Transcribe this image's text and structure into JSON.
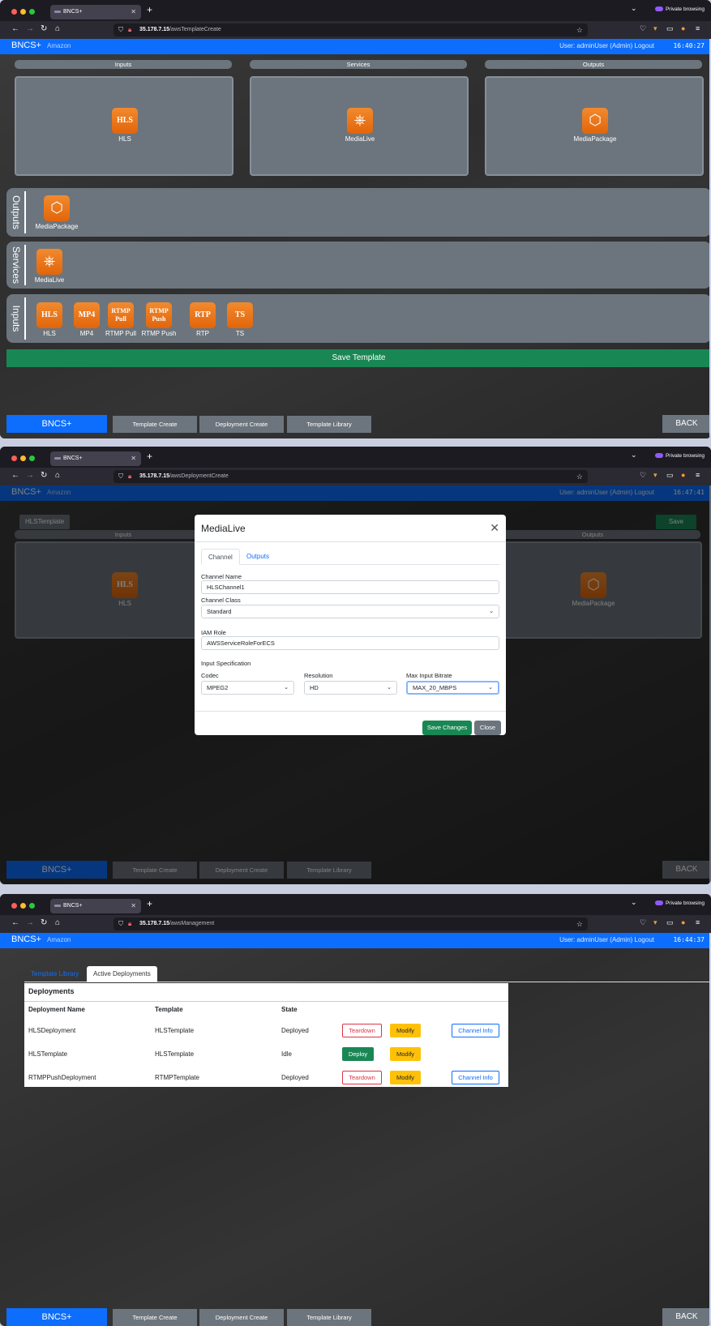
{
  "windows": [
    {
      "tab_title": "BNCS+",
      "private_label": "Private browsing",
      "url_host": "35.178.7.15",
      "url_path": "/awsTemplateCreate",
      "app": {
        "brand": "BNCS+",
        "provider": "Amazon",
        "user": "User: adminUser (Admin)  Logout",
        "clock": "16:40:27"
      },
      "columns": [
        {
          "header": "Inputs",
          "items": [
            {
              "icon": "HLS",
              "label": "HLS"
            }
          ]
        },
        {
          "header": "Services",
          "items": [
            {
              "icon": "medialive-icon",
              "label": "MediaLive"
            }
          ]
        },
        {
          "header": "Outputs",
          "items": [
            {
              "icon": "mediapackage-icon",
              "label": "MediaPackage"
            }
          ]
        }
      ],
      "palette": [
        {
          "section": "Outputs",
          "items": [
            {
              "icon": "mediapackage-icon",
              "label": "MediaPackage"
            }
          ]
        },
        {
          "section": "Services",
          "items": [
            {
              "icon": "medialive-icon",
              "label": "MediaLive"
            }
          ]
        },
        {
          "section": "Inputs",
          "items": [
            {
              "icon": "HLS",
              "label": "HLS"
            },
            {
              "icon": "MP4",
              "label": "MP4"
            },
            {
              "icon_line1": "RTMP",
              "icon_line2": "Pull",
              "label": "RTMP Pull"
            },
            {
              "icon_line1": "RTMP",
              "icon_line2": "Push",
              "label": "RTMP Push"
            },
            {
              "icon": "RTP",
              "label": "RTP"
            },
            {
              "icon": "TS",
              "label": "TS"
            }
          ]
        }
      ],
      "save_button": "Save Template",
      "bottom_nav": {
        "brand": "BNCS+",
        "items": [
          "Template Create",
          "Deployment Create",
          "Template Library"
        ],
        "back": "BACK"
      }
    },
    {
      "tab_title": "BNCS+",
      "private_label": "Private browsing",
      "url_host": "35.178.7.15",
      "url_path": "/awsDeploymentCreate",
      "app": {
        "brand": "BNCS+",
        "provider": "Amazon",
        "user": "User: adminUser (Admin)  Logout",
        "clock": "16:47:41"
      },
      "template_name": "HLSTemplate",
      "save_button": "Save",
      "columns": [
        {
          "header": "Inputs",
          "items": [
            {
              "icon": "HLS",
              "label": "HLS"
            }
          ]
        },
        {
          "header": "Outputs",
          "items": [
            {
              "icon": "mediapackage-icon",
              "label": "MediaPackage"
            }
          ]
        }
      ],
      "modal": {
        "title": "MediaLive",
        "tabs": [
          "Channel",
          "Outputs"
        ],
        "fields": {
          "channel_name": {
            "label": "Channel Name",
            "value": "HLSChannel1"
          },
          "channel_class": {
            "label": "Channel Class",
            "value": "Standard"
          },
          "iam_role": {
            "label": "IAM Role",
            "value": "AWSServiceRoleForECS"
          },
          "input_spec_label": "Input Specification",
          "codec": {
            "label": "Codec",
            "value": "MPEG2"
          },
          "resolution": {
            "label": "Resolution",
            "value": "HD"
          },
          "max_bitrate": {
            "label": "Max Input Bitrate",
            "value": "MAX_20_MBPS"
          }
        },
        "save": "Save Changes",
        "close": "Close"
      },
      "bottom_nav": {
        "brand": "BNCS+",
        "items": [
          "Template Create",
          "Deployment Create",
          "Template Library"
        ],
        "back": "BACK"
      }
    },
    {
      "tab_title": "BNCS+",
      "private_label": "Private browsing",
      "url_host": "35.178.7.15",
      "url_path": "/awsManagement",
      "app": {
        "brand": "BNCS+",
        "provider": "Amazon",
        "user": "User: adminUser (Admin)  Logout",
        "clock": "16:44:37"
      },
      "tabs": [
        "Template Library",
        "Active Deployments"
      ],
      "deployments": {
        "title": "Deployments",
        "headers": [
          "Deployment Name",
          "Template",
          "State"
        ],
        "rows": [
          {
            "name": "HLSDeployment",
            "template": "HLSTemplate",
            "state": "Deployed",
            "primary": "Teardown",
            "modify": "Modify",
            "info": "Channel Info"
          },
          {
            "name": "HLSTemplate",
            "template": "HLSTemplate",
            "state": "Idle",
            "primary": "Deploy",
            "modify": "Modify",
            "info": ""
          },
          {
            "name": "RTMPPushDeployment",
            "template": "RTMPTemplate",
            "state": "Deployed",
            "primary": "Teardown",
            "modify": "Modify",
            "info": "Channel Info"
          }
        ]
      },
      "bottom_nav": {
        "brand": "BNCS+",
        "items": [
          "Template Create",
          "Deployment Create",
          "Template Library"
        ],
        "back": "BACK"
      }
    }
  ]
}
